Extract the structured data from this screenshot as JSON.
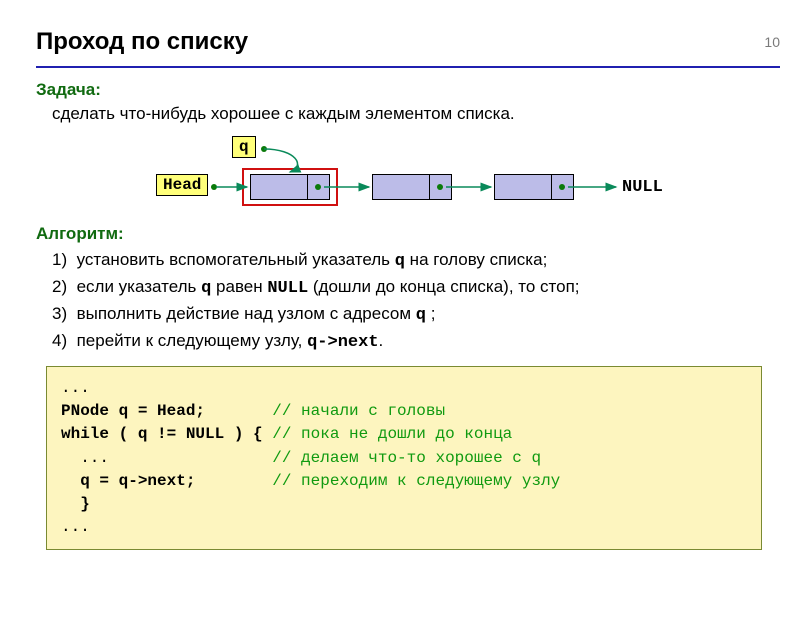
{
  "page_number": "10",
  "title": "Проход по списку",
  "task": {
    "label": "Задача:",
    "text": "сделать что-нибудь хорошее с каждым элементом списка."
  },
  "diagram": {
    "q_label": "q",
    "head_label": "Head",
    "null_label": "NULL"
  },
  "algorithm": {
    "label": "Алгоритм:",
    "items": [
      {
        "num": "1)",
        "pre": "установить вспомогательный указатель ",
        "mono": "q",
        "post": " на голову списка;"
      },
      {
        "num": "2)",
        "pre": "если указатель ",
        "mono": "q",
        "post_a": "  равен ",
        "mono2": "NULL",
        "post": " (дошли до конца списка), то стоп;"
      },
      {
        "num": "3)",
        "pre": "выполнить действие над узлом с адресом ",
        "mono": "q",
        "post": " ;"
      },
      {
        "num": "4)",
        "pre": "перейти к следующему узлу, ",
        "mono": "q->next",
        "post": "."
      }
    ]
  },
  "code": {
    "l1": "...",
    "l2a": "PNode q = Head;       ",
    "c2": "// начали с головы",
    "l3a": "while ( q != NULL ) { ",
    "c3": "// пока не дошли до конца",
    "l4a": "  ...                 ",
    "c4": "// делаем что-то хорошее с q",
    "l5a": "  q = q->next;        ",
    "c5": "// переходим к следующему узлу",
    "l6": "  }",
    "l7": "..."
  }
}
